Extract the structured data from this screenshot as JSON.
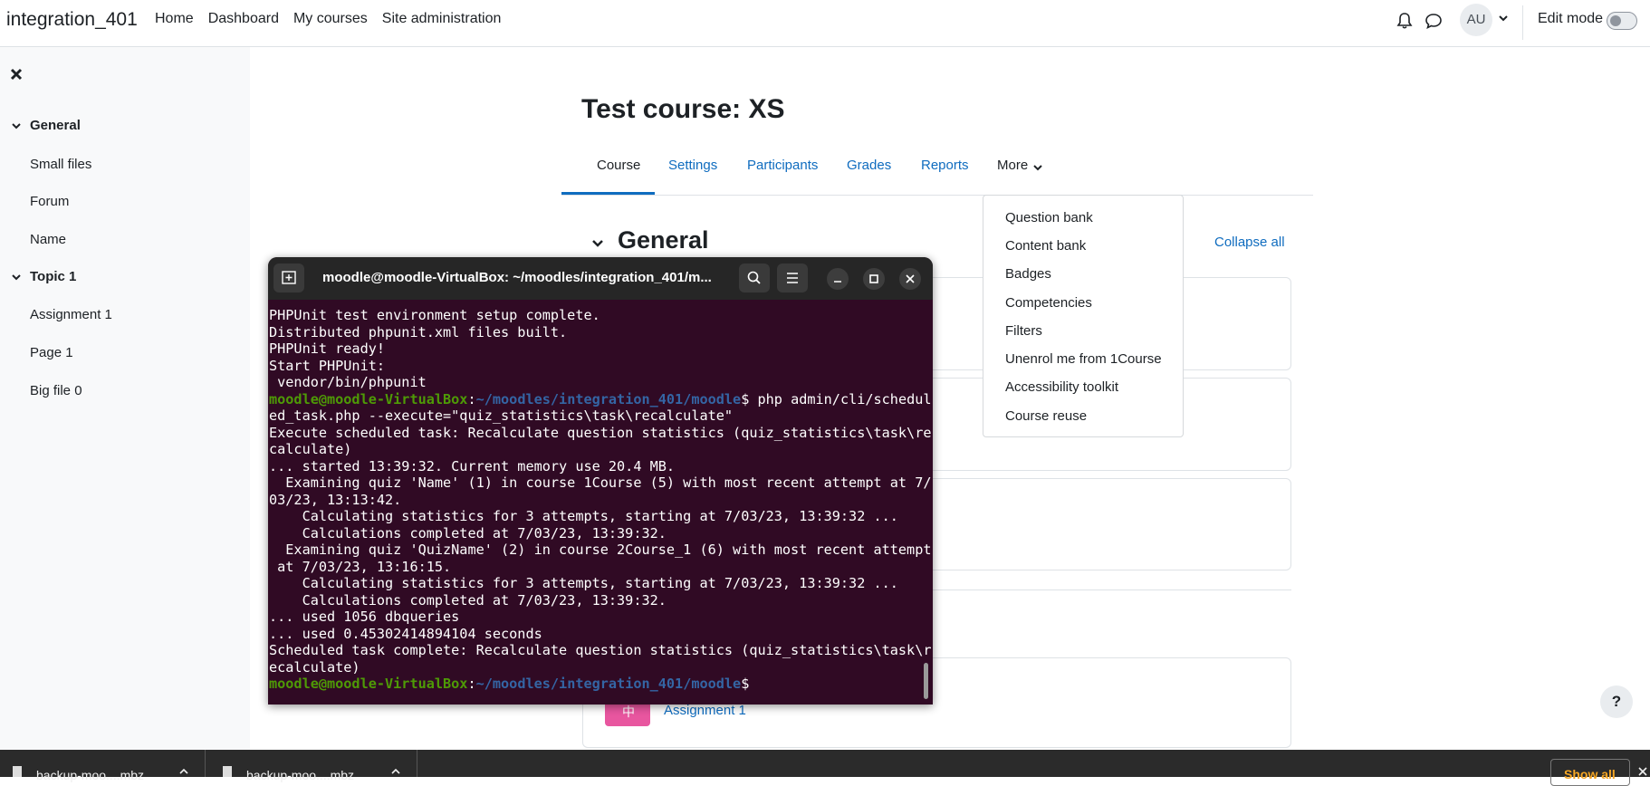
{
  "navbar": {
    "brand": "integration_401",
    "links": [
      "Home",
      "Dashboard",
      "My courses",
      "Site administration"
    ],
    "avatar_initials": "AU",
    "edit_mode_label": "Edit mode"
  },
  "drawer": {
    "sections": [
      {
        "title": "General",
        "items": [
          "Small files",
          "Forum",
          "Name"
        ]
      },
      {
        "title": "Topic 1",
        "items": [
          "Assignment 1",
          "Page 1",
          "Big file 0"
        ]
      }
    ]
  },
  "course": {
    "title": "Test course: XS",
    "tabs": [
      "Course",
      "Settings",
      "Participants",
      "Grades",
      "Reports",
      "More"
    ],
    "active_tab": "Course",
    "more_menu": [
      "Question bank",
      "Content bank",
      "Badges",
      "Competencies",
      "Filters",
      "Unenrol me from 1Course",
      "Accessibility toolkit",
      "Course reuse"
    ],
    "section_heading": "General",
    "collapse_all": "Collapse all",
    "activity_label": "Assignment 1",
    "help_label": "?"
  },
  "terminal": {
    "title": "moodle@moodle-VirtualBox: ~/moodles/integration_401/m...",
    "prompt_user": "moodle@moodle-VirtualBox",
    "prompt_path": "~/moodles/integration_401/moodle",
    "lines": [
      "PHPUnit test environment setup complete.",
      "Distributed phpunit.xml files built.",
      "PHPUnit ready!",
      "Start PHPUnit:",
      " vendor/bin/phpunit",
      "$ php admin/cli/schedul",
      "ed_task.php --execute=\"quiz_statistics\\task\\recalculate\"",
      "Execute scheduled task: Recalculate question statistics (quiz_statistics\\task\\re",
      "calculate)",
      "... started 13:39:32. Current memory use 20.4 MB.",
      "  Examining quiz 'Name' (1) in course 1Course (5) with most recent attempt at 7/",
      "03/23, 13:13:42.",
      "    Calculating statistics for 3 attempts, starting at 7/03/23, 13:39:32 ...",
      "    Calculations completed at 7/03/23, 13:39:32.",
      "  Examining quiz 'QuizName' (2) in course 2Course_1 (6) with most recent attempt",
      " at 7/03/23, 13:16:15.",
      "    Calculating statistics for 3 attempts, starting at 7/03/23, 13:39:32 ...",
      "    Calculations completed at 7/03/23, 13:39:32.",
      "... used 1056 dbqueries",
      "... used 0.45302414894104 seconds",
      "Scheduled task complete: Recalculate question statistics (quiz_statistics\\task\\r",
      "ecalculate)",
      "$"
    ]
  },
  "downloads": {
    "items": [
      "backup-moo....mbz",
      "backup-moo....mbz"
    ],
    "show_all": "Show all"
  }
}
